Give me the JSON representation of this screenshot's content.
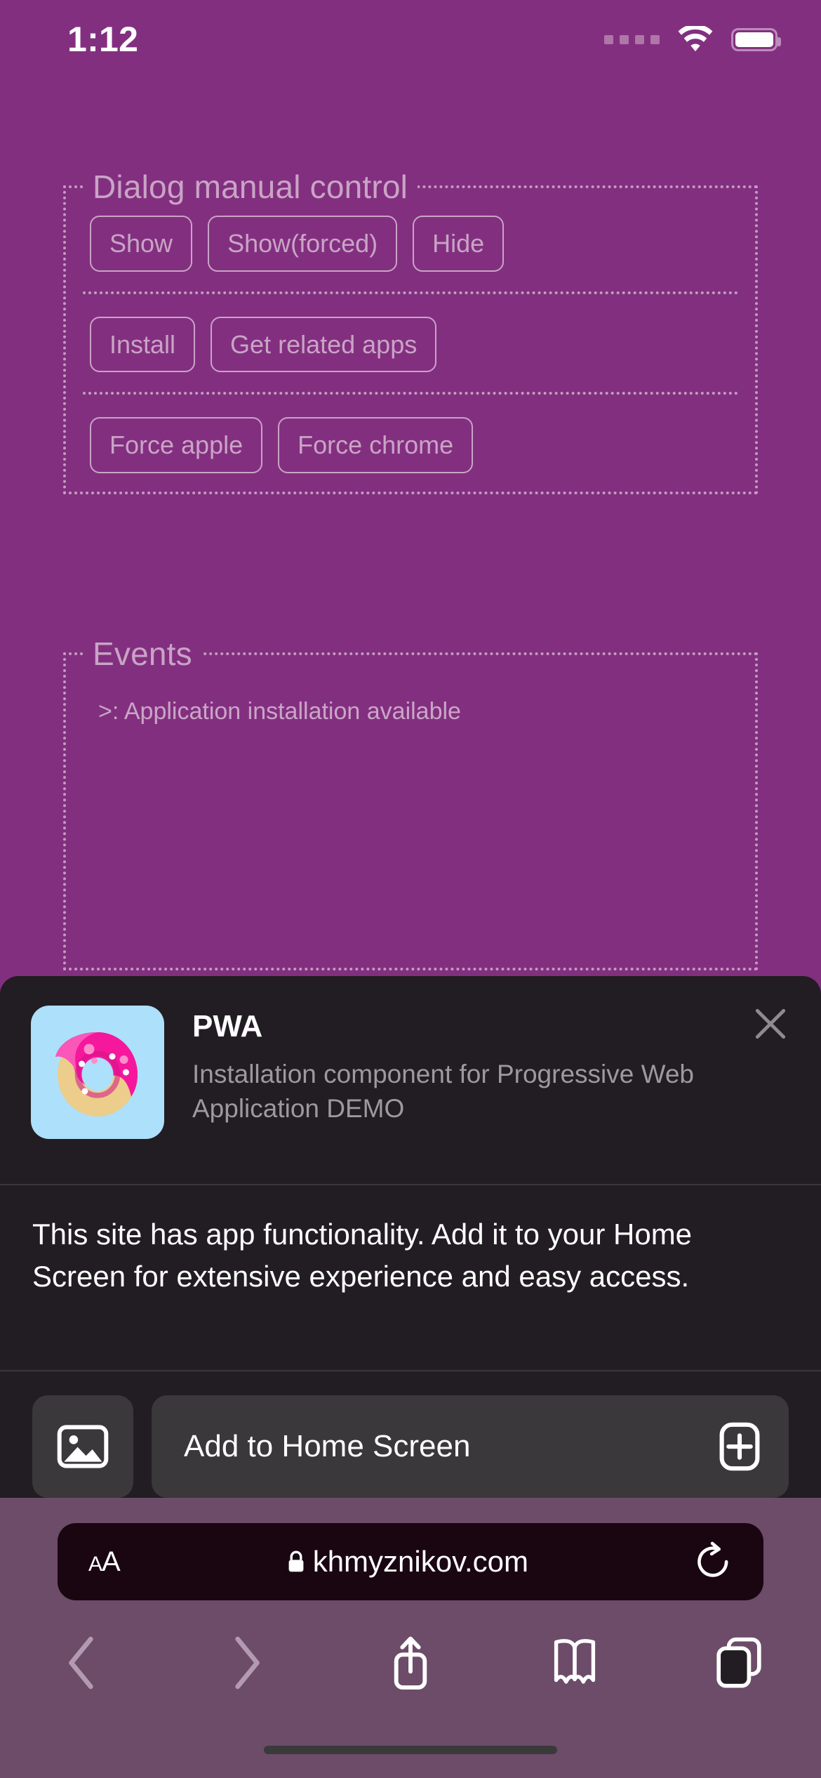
{
  "status_bar": {
    "time": "1:12",
    "signal_icon": "signal-dots-icon",
    "wifi_icon": "wifi-icon",
    "battery_icon": "battery-full-icon"
  },
  "page": {
    "dialog_section": {
      "legend": "Dialog manual control",
      "rows": [
        {
          "buttons": [
            {
              "label": "Show",
              "name": "show-button"
            },
            {
              "label": "Show(forced)",
              "name": "show-forced-button"
            },
            {
              "label": "Hide",
              "name": "hide-button"
            }
          ]
        },
        {
          "buttons": [
            {
              "label": "Install",
              "name": "install-button"
            },
            {
              "label": "Get related apps",
              "name": "get-related-apps-button"
            }
          ]
        },
        {
          "buttons": [
            {
              "label": "Force apple",
              "name": "force-apple-button"
            },
            {
              "label": "Force chrome",
              "name": "force-chrome-button"
            }
          ]
        }
      ]
    },
    "events_section": {
      "legend": "Events",
      "entries": [
        ">: Application installation available"
      ]
    }
  },
  "install_sheet": {
    "app_icon": "donut-app-icon",
    "app_title": "PWA",
    "app_description": "Installation component for Progressive Web Application DEMO",
    "close_icon": "close-icon",
    "message": "This site has app functionality. Add it to your Home Screen for extensive experience and easy access.",
    "gallery_button": {
      "icon": "photo-image-icon",
      "name": "gallery-button"
    },
    "primary_button": {
      "label": "Add to Home Screen",
      "icon": "plus-square-icon"
    }
  },
  "safari": {
    "text_size_label": "AA",
    "lock_icon": "lock-icon",
    "url": "khmyznikov.com",
    "reload_icon": "reload-icon",
    "toolbar": [
      {
        "name": "back-button",
        "icon": "chevron-left-icon"
      },
      {
        "name": "forward-button",
        "icon": "chevron-right-icon"
      },
      {
        "name": "share-button",
        "icon": "share-icon"
      },
      {
        "name": "bookmarks-button",
        "icon": "book-icon"
      },
      {
        "name": "tabs-button",
        "icon": "tabs-icon"
      }
    ],
    "home_indicator": "home-indicator"
  },
  "colors": {
    "page_background": "#832f80",
    "fieldset_border": "#c49dc0",
    "control_text": "#c9a4c5",
    "sheet_background": "#211d22",
    "sheet_button": "#3a383a",
    "safari_bar": "#6c4c68",
    "url_pill": "#190611",
    "app_icon_background": "#ade0fa",
    "donut_glaze": "#f5189c",
    "donut_dough": "#eccd8c"
  }
}
